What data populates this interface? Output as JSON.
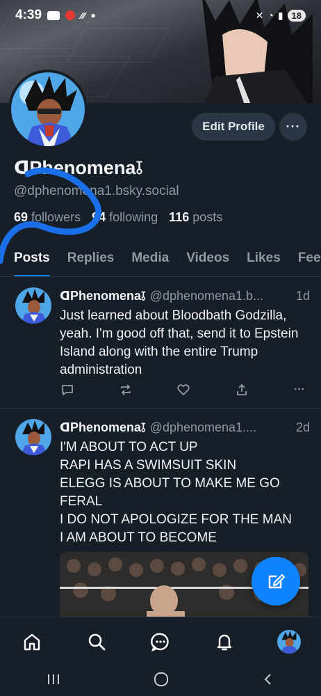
{
  "status": {
    "time": "4:39",
    "battery": "18"
  },
  "profile": {
    "display_name": "ᗡPhenomena⫱",
    "handle": "@dphenomena1.bsky.social",
    "followers_count": "69",
    "followers_label": "followers",
    "following_count": "94",
    "following_label": "following",
    "posts_count": "116",
    "posts_label": "posts",
    "edit_label": "Edit Profile",
    "more_label": "···"
  },
  "tabs": [
    {
      "label": "Posts",
      "active": true
    },
    {
      "label": "Replies"
    },
    {
      "label": "Media"
    },
    {
      "label": "Videos"
    },
    {
      "label": "Likes"
    },
    {
      "label": "Feeds"
    }
  ],
  "posts": [
    {
      "author": "ᗡPhenomena⫱",
      "handle": "@dphenomena1.b...",
      "time": "1d",
      "text": "Just learned about Bloodbath Godzilla, yeah. I'm good off that, send it to Epstein Island along with the entire Trump administration"
    },
    {
      "author": "ᗡPhenomena⫱",
      "handle": "@dphenomena1....",
      "time": "2d",
      "lines": [
        "I'M ABOUT TO ACT UP",
        "RAPI HAS A SWIMSUIT SKIN",
        "ELEGG IS ABOUT TO MAKE ME GO",
        "FERAL",
        "I DO NOT APOLOGIZE FOR THE MAN",
        "I AM ABOUT TO BECOME"
      ]
    }
  ],
  "icons": {
    "reply": "reply-icon",
    "repost": "repost-icon",
    "like": "heart-icon",
    "share": "share-icon",
    "more": "more-icon",
    "compose": "compose-icon",
    "home": "home-icon",
    "search": "search-icon",
    "chat": "chat-icon",
    "notifications": "bell-icon"
  },
  "colors": {
    "background": "#161e27",
    "accent": "#1083fe",
    "muted": "#8d9aa8"
  }
}
